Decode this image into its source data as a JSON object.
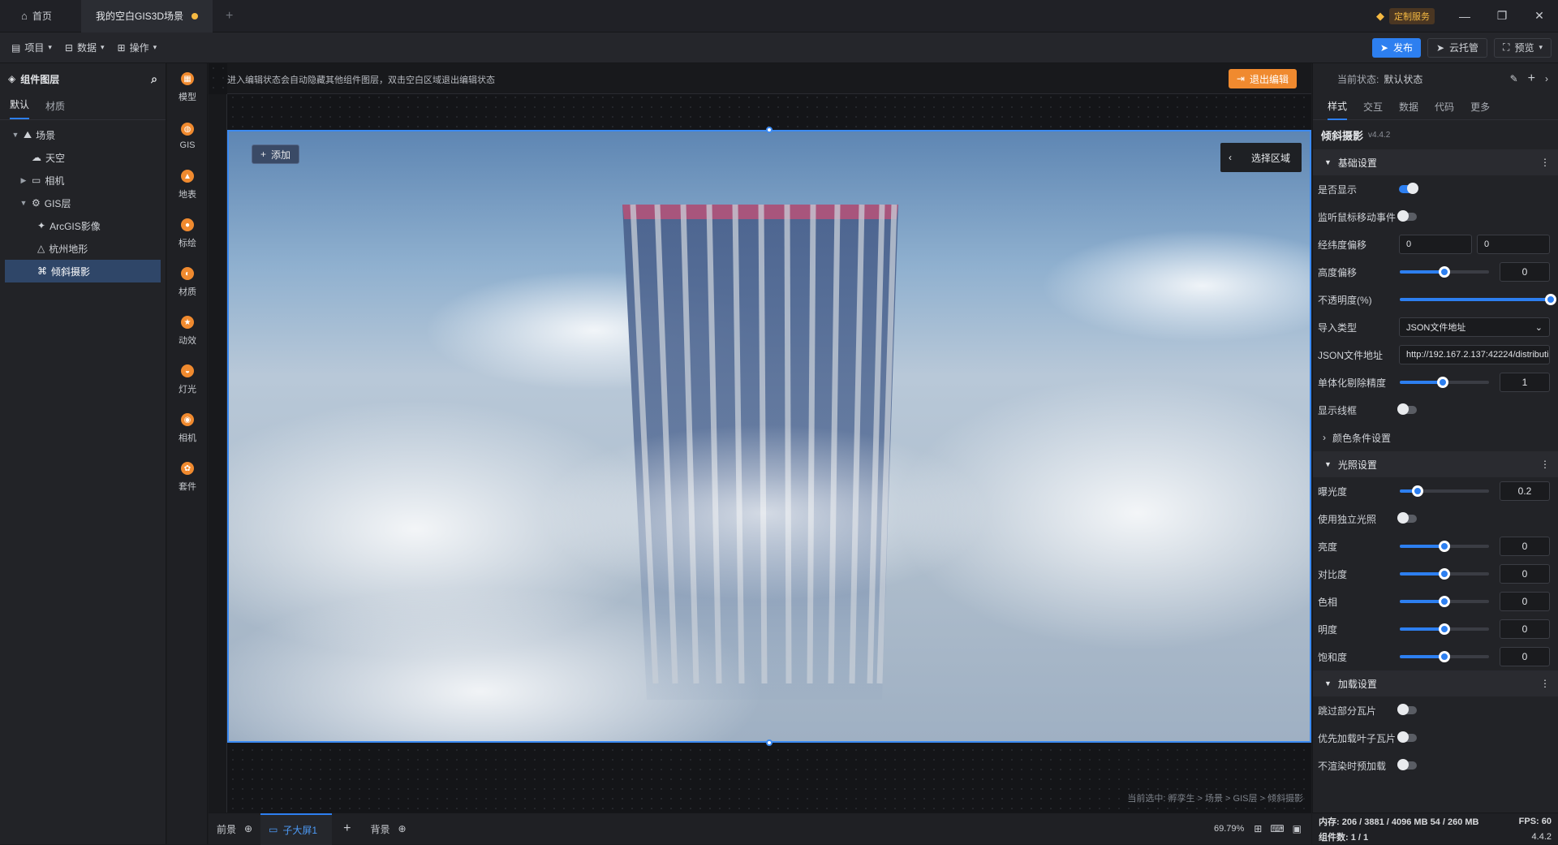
{
  "titlebar": {
    "home_label": "首页",
    "doc_tab": "我的空白GIS3D场景",
    "service_label": "定制服务",
    "accent": "#f5b942"
  },
  "menubar": {
    "project": "项目",
    "data": "数据",
    "operate": "操作",
    "publish": "发布",
    "cloud": "云托管",
    "preview": "预览"
  },
  "leftpanel": {
    "title": "组件图层",
    "tabs": [
      "默认",
      "材质"
    ],
    "tree": [
      {
        "label": "场景"
      },
      {
        "label": "天空"
      },
      {
        "label": "相机"
      },
      {
        "label": "GIS层"
      },
      {
        "label": "ArcGIS影像"
      },
      {
        "label": "杭州地形"
      },
      {
        "label": "倾斜摄影"
      }
    ]
  },
  "tools": [
    {
      "label": "模型"
    },
    {
      "label": "GIS"
    },
    {
      "label": "地表"
    },
    {
      "label": "标绘"
    },
    {
      "label": "材质"
    },
    {
      "label": "动效"
    },
    {
      "label": "灯光"
    },
    {
      "label": "相机"
    },
    {
      "label": "套件"
    }
  ],
  "canvas": {
    "hint": "进入编辑状态会自动隐藏其他组件图层，双击空白区域退出编辑状态",
    "exit_edit": "退出编辑",
    "add_label": "添加",
    "select_area": "选择区域",
    "breadcrumb": "当前选中: 孵孪生 > 场景 > GIS层 > 倾斜摄影"
  },
  "rightpanel": {
    "state_label": "当前状态:",
    "state_value": "默认状态",
    "tabs": [
      "样式",
      "交互",
      "数据",
      "代码",
      "更多"
    ],
    "component_name": "倾斜摄影",
    "version": "v4.4.2",
    "sections": {
      "basic": "基础设置",
      "light": "光照设置",
      "load": "加载设置",
      "color_cond": "颜色条件设置"
    },
    "basic": {
      "visible": "是否显示",
      "mouse_event": "监听鼠标移动事件",
      "lnglat_offset": "经纬度偏移",
      "lng_value": "0",
      "lat_value": "0",
      "height_offset": "高度偏移",
      "height_value": "0",
      "opacity": "不透明度(%)",
      "import_type": "导入类型",
      "import_value": "JSON文件地址",
      "json_url_label": "JSON文件地址",
      "json_url_value": "http://192.167.2.137:42224/distributi",
      "precision": "单体化剔除精度",
      "precision_value": "1",
      "wireframe": "显示线框"
    },
    "light": {
      "exposure": "曝光度",
      "exposure_value": "0.2",
      "independent": "使用独立光照",
      "brightness": "亮度",
      "brightness_value": "0",
      "contrast": "对比度",
      "contrast_value": "0",
      "hue": "色相",
      "hue_value": "0",
      "lightness": "明度",
      "lightness_value": "0",
      "saturation": "饱和度",
      "saturation_value": "0"
    },
    "load": {
      "skip_tiles": "跳过部分瓦片",
      "prefer_leaf": "优先加载叶子瓦片",
      "no_preload": "不渲染时预加载"
    }
  },
  "bottombar": {
    "front": "前景",
    "screen": "子大屏1",
    "back": "背景",
    "zoom": "69.79%"
  },
  "status": {
    "memory": "内存:  206 / 3881 / 4096 MB  54 / 260 MB",
    "fps": "FPS:  60",
    "component_count": "组件数: 1 / 1",
    "version": "4.4.2"
  },
  "values": {
    "height_slider": 0.5,
    "opacity_slider": 1.0,
    "precision_slider": 0.48,
    "exposure_slider": 0.2,
    "light_slider": 0.5
  }
}
